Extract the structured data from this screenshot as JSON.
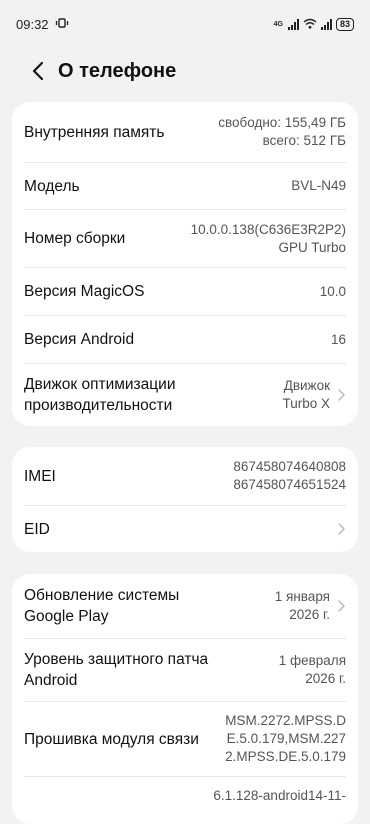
{
  "status_bar": {
    "time": "09:32",
    "network_label": "4G",
    "battery": "83"
  },
  "header": {
    "title": "О телефоне"
  },
  "card1": {
    "storage": {
      "label": "Внутренняя память",
      "free": "свободно: 155,49 ГБ",
      "total": "всего: 512 ГБ"
    },
    "model": {
      "label": "Модель",
      "value": "BVL-N49"
    },
    "build": {
      "label": "Номер сборки",
      "value_line1": "10.0.0.138(C636E3R2P2)",
      "value_line2": "GPU Turbo"
    },
    "magicos": {
      "label": "Версия MagicOS",
      "value": "10.0"
    },
    "android": {
      "label": "Версия Android",
      "value": "16"
    },
    "engine": {
      "label_line1": "Движок оптимизации",
      "label_line2": "производительности",
      "value_line1": "Движок",
      "value_line2": "Turbo X"
    }
  },
  "card2": {
    "imei": {
      "label": "IMEI",
      "value_line1": "867458074640808",
      "value_line2": "867458074651524"
    },
    "eid": {
      "label": "EID"
    }
  },
  "card3": {
    "gplay": {
      "label_line1": "Обновление системы",
      "label_line2": "Google Play",
      "value_line1": "1 января",
      "value_line2": "2026 г."
    },
    "patch": {
      "label_line1": "Уровень защитного патча",
      "label_line2": "Android",
      "value_line1": "1 февраля",
      "value_line2": "2026 г."
    },
    "baseband": {
      "label": "Прошивка модуля связи",
      "value_line1": "MSM.2272.MPSS.D",
      "value_line2": "E.5.0.179,MSM.227",
      "value_line3": "2.MPSS.DE.5.0.179"
    },
    "kernel": {
      "value_line1": "6.1.128-android14-11-"
    }
  }
}
